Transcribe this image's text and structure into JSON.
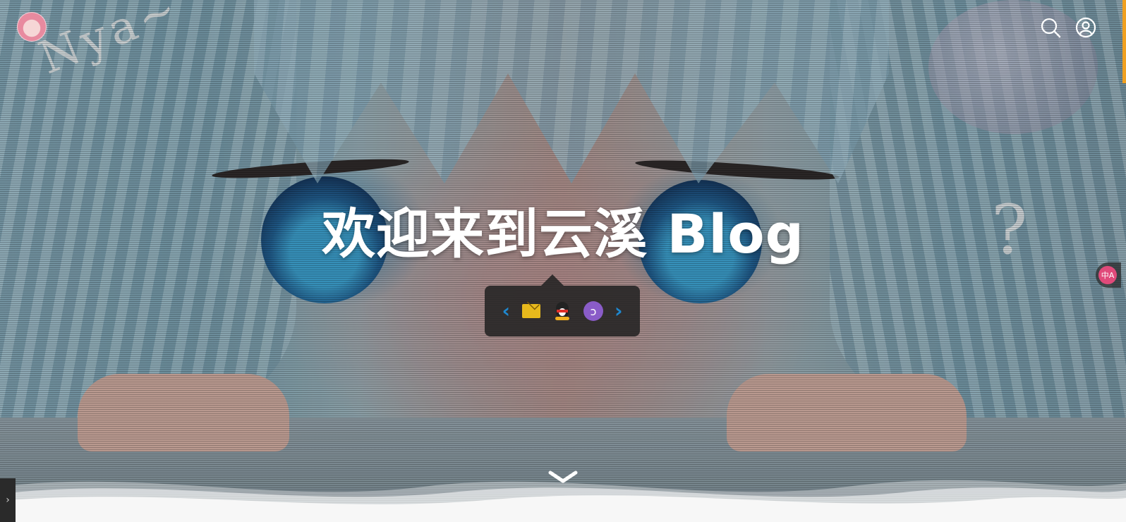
{
  "site": {
    "title": "欢迎来到云溪 Blog",
    "avatar_alt": "avatar"
  },
  "header": {
    "search_icon": "search-icon",
    "user_icon": "user-icon"
  },
  "decorations": {
    "doodle_left": "Nya~",
    "doodle_right": "?"
  },
  "social": {
    "prev_icon": "chevron-left-icon",
    "next_icon": "chevron-right-icon",
    "prev_glyph": "‹",
    "next_glyph": "›",
    "items": [
      {
        "name": "mail-icon"
      },
      {
        "name": "qq-icon"
      },
      {
        "name": "astro-icon"
      }
    ]
  },
  "translate": {
    "label": "中A"
  },
  "drawer": {
    "glyph": "›"
  },
  "colors": {
    "accent": "#1e88d0",
    "scroll_indicator": "#f0a020",
    "translate_badge": "#e04a7a",
    "title": "#ffffff"
  }
}
